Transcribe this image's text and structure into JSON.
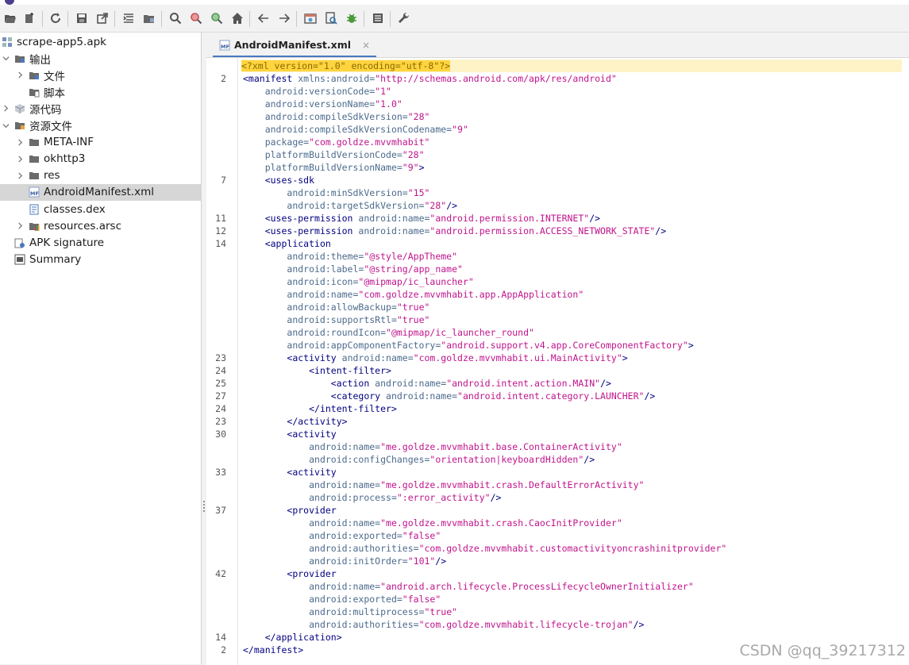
{
  "tree": {
    "items": [
      {
        "label": "scrape-app5.apk",
        "indent": 0,
        "chev": "none",
        "icon": "apk-icon"
      },
      {
        "label": "输出",
        "indent": 1,
        "chev": "down",
        "icon": "folder-output-icon"
      },
      {
        "label": "文件",
        "indent": 2,
        "chev": "right",
        "icon": "folder-output-icon"
      },
      {
        "label": "脚本",
        "indent": 2,
        "chev": "blank",
        "icon": "script-folder-icon"
      },
      {
        "label": "源代码",
        "indent": 1,
        "chev": "right",
        "icon": "package-icon"
      },
      {
        "label": "资源文件",
        "indent": 1,
        "chev": "down",
        "icon": "resources-folder-icon"
      },
      {
        "label": "META-INF",
        "indent": 2,
        "chev": "right",
        "icon": "folder-icon"
      },
      {
        "label": "okhttp3",
        "indent": 2,
        "chev": "right",
        "icon": "folder-icon"
      },
      {
        "label": "res",
        "indent": 2,
        "chev": "right",
        "icon": "folder-icon"
      },
      {
        "label": "AndroidManifest.xml",
        "indent": 2,
        "chev": "blank",
        "icon": "manifest-file-icon",
        "selected": true
      },
      {
        "label": "classes.dex",
        "indent": 2,
        "chev": "blank",
        "icon": "dex-file-icon"
      },
      {
        "label": "resources.arsc",
        "indent": 2,
        "chev": "right",
        "icon": "arsc-file-icon"
      },
      {
        "label": "APK signature",
        "indent": 1,
        "chev": "blank",
        "icon": "signature-icon"
      },
      {
        "label": "Summary",
        "indent": 1,
        "chev": "blank",
        "icon": "summary-icon"
      }
    ]
  },
  "editor": {
    "tab_label": "AndroidManifest.xml",
    "tab_close": "×",
    "gutter": [
      "",
      "2",
      "",
      "",
      "",
      "",
      "",
      "",
      "",
      "7",
      "",
      "",
      "11",
      "12",
      "14",
      "",
      "",
      "",
      "",
      "",
      "",
      "",
      "",
      "23",
      "24",
      "25",
      "27",
      "24",
      "23",
      "30",
      "",
      "",
      "33",
      "",
      "",
      "37",
      "",
      "",
      "",
      "",
      "42",
      "",
      "",
      "",
      "",
      "14",
      "2"
    ],
    "lines": [
      [
        [
          "decl",
          "<?xml version=\"1.0\" encoding=\"utf-8\"?>"
        ]
      ],
      [
        [
          "t",
          "<manifest "
        ],
        [
          "a",
          "xmlns:android="
        ],
        [
          "v",
          "\"http://schemas.android.com/apk/res/android\""
        ]
      ],
      [
        [
          "",
          "    "
        ],
        [
          "a",
          "android:versionCode="
        ],
        [
          "v",
          "\"1\""
        ]
      ],
      [
        [
          "",
          "    "
        ],
        [
          "a",
          "android:versionName="
        ],
        [
          "v",
          "\"1.0\""
        ]
      ],
      [
        [
          "",
          "    "
        ],
        [
          "a",
          "android:compileSdkVersion="
        ],
        [
          "v",
          "\"28\""
        ]
      ],
      [
        [
          "",
          "    "
        ],
        [
          "a",
          "android:compileSdkVersionCodename="
        ],
        [
          "v",
          "\"9\""
        ]
      ],
      [
        [
          "",
          "    "
        ],
        [
          "a",
          "package="
        ],
        [
          "v",
          "\"com.goldze.mvvmhabit\""
        ]
      ],
      [
        [
          "",
          "    "
        ],
        [
          "a",
          "platformBuildVersionCode="
        ],
        [
          "v",
          "\"28\""
        ]
      ],
      [
        [
          "",
          "    "
        ],
        [
          "a",
          "platformBuildVersionName="
        ],
        [
          "v",
          "\"9\""
        ],
        [
          "t",
          ">"
        ]
      ],
      [
        [
          "",
          "    "
        ],
        [
          "t",
          "<uses-sdk"
        ]
      ],
      [
        [
          "",
          "        "
        ],
        [
          "a",
          "android:minSdkVersion="
        ],
        [
          "v",
          "\"15\""
        ]
      ],
      [
        [
          "",
          "        "
        ],
        [
          "a",
          "android:targetSdkVersion="
        ],
        [
          "v",
          "\"28\""
        ],
        [
          "t",
          "/>"
        ]
      ],
      [
        [
          "",
          "    "
        ],
        [
          "t",
          "<uses-permission "
        ],
        [
          "a",
          "android:name="
        ],
        [
          "v",
          "\"android.permission.INTERNET\""
        ],
        [
          "t",
          "/>"
        ]
      ],
      [
        [
          "",
          "    "
        ],
        [
          "t",
          "<uses-permission "
        ],
        [
          "a",
          "android:name="
        ],
        [
          "v",
          "\"android.permission.ACCESS_NETWORK_STATE\""
        ],
        [
          "t",
          "/>"
        ]
      ],
      [
        [
          "",
          "    "
        ],
        [
          "t",
          "<application"
        ]
      ],
      [
        [
          "",
          "        "
        ],
        [
          "a",
          "android:theme="
        ],
        [
          "v",
          "\"@style/AppTheme\""
        ]
      ],
      [
        [
          "",
          "        "
        ],
        [
          "a",
          "android:label="
        ],
        [
          "v",
          "\"@string/app_name\""
        ]
      ],
      [
        [
          "",
          "        "
        ],
        [
          "a",
          "android:icon="
        ],
        [
          "v",
          "\"@mipmap/ic_launcher\""
        ]
      ],
      [
        [
          "",
          "        "
        ],
        [
          "a",
          "android:name="
        ],
        [
          "v",
          "\"com.goldze.mvvmhabit.app.AppApplication\""
        ]
      ],
      [
        [
          "",
          "        "
        ],
        [
          "a",
          "android:allowBackup="
        ],
        [
          "v",
          "\"true\""
        ]
      ],
      [
        [
          "",
          "        "
        ],
        [
          "a",
          "android:supportsRtl="
        ],
        [
          "v",
          "\"true\""
        ]
      ],
      [
        [
          "",
          "        "
        ],
        [
          "a",
          "android:roundIcon="
        ],
        [
          "v",
          "\"@mipmap/ic_launcher_round\""
        ]
      ],
      [
        [
          "",
          "        "
        ],
        [
          "a",
          "android:appComponentFactory="
        ],
        [
          "v",
          "\"android.support.v4.app.CoreComponentFactory\""
        ],
        [
          "t",
          ">"
        ]
      ],
      [
        [
          "",
          "        "
        ],
        [
          "t",
          "<activity "
        ],
        [
          "a",
          "android:name="
        ],
        [
          "v",
          "\"com.goldze.mvvmhabit.ui.MainActivity\""
        ],
        [
          "t",
          ">"
        ]
      ],
      [
        [
          "",
          "            "
        ],
        [
          "t",
          "<intent-filter>"
        ]
      ],
      [
        [
          "",
          "                "
        ],
        [
          "t",
          "<action "
        ],
        [
          "a",
          "android:name="
        ],
        [
          "v",
          "\"android.intent.action.MAIN\""
        ],
        [
          "t",
          "/>"
        ]
      ],
      [
        [
          "",
          "                "
        ],
        [
          "t",
          "<category "
        ],
        [
          "a",
          "android:name="
        ],
        [
          "v",
          "\"android.intent.category.LAUNCHER\""
        ],
        [
          "t",
          "/>"
        ]
      ],
      [
        [
          "",
          "            "
        ],
        [
          "t",
          "</intent-filter>"
        ]
      ],
      [
        [
          "",
          "        "
        ],
        [
          "t",
          "</activity>"
        ]
      ],
      [
        [
          "",
          "        "
        ],
        [
          "t",
          "<activity"
        ]
      ],
      [
        [
          "",
          "            "
        ],
        [
          "a",
          "android:name="
        ],
        [
          "v",
          "\"me.goldze.mvvmhabit.base.ContainerActivity\""
        ]
      ],
      [
        [
          "",
          "            "
        ],
        [
          "a",
          "android:configChanges="
        ],
        [
          "v",
          "\"orientation|keyboardHidden\""
        ],
        [
          "t",
          "/>"
        ]
      ],
      [
        [
          "",
          "        "
        ],
        [
          "t",
          "<activity"
        ]
      ],
      [
        [
          "",
          "            "
        ],
        [
          "a",
          "android:name="
        ],
        [
          "v",
          "\"me.goldze.mvvmhabit.crash.DefaultErrorActivity\""
        ]
      ],
      [
        [
          "",
          "            "
        ],
        [
          "a",
          "android:process="
        ],
        [
          "v",
          "\":error_activity\""
        ],
        [
          "t",
          "/>"
        ]
      ],
      [
        [
          "",
          "        "
        ],
        [
          "t",
          "<provider"
        ]
      ],
      [
        [
          "",
          "            "
        ],
        [
          "a",
          "android:name="
        ],
        [
          "v",
          "\"me.goldze.mvvmhabit.crash.CaocInitProvider\""
        ]
      ],
      [
        [
          "",
          "            "
        ],
        [
          "a",
          "android:exported="
        ],
        [
          "v",
          "\"false\""
        ]
      ],
      [
        [
          "",
          "            "
        ],
        [
          "a",
          "android:authorities="
        ],
        [
          "v",
          "\"com.goldze.mvvmhabit.customactivityoncrashinitprovider\""
        ]
      ],
      [
        [
          "",
          "            "
        ],
        [
          "a",
          "android:initOrder="
        ],
        [
          "v",
          "\"101\""
        ],
        [
          "t",
          "/>"
        ]
      ],
      [
        [
          "",
          "        "
        ],
        [
          "t",
          "<provider"
        ]
      ],
      [
        [
          "",
          "            "
        ],
        [
          "a",
          "android:name="
        ],
        [
          "v",
          "\"android.arch.lifecycle.ProcessLifecycleOwnerInitializer\""
        ]
      ],
      [
        [
          "",
          "            "
        ],
        [
          "a",
          "android:exported="
        ],
        [
          "v",
          "\"false\""
        ]
      ],
      [
        [
          "",
          "            "
        ],
        [
          "a",
          "android:multiprocess="
        ],
        [
          "v",
          "\"true\""
        ]
      ],
      [
        [
          "",
          "            "
        ],
        [
          "a",
          "android:authorities="
        ],
        [
          "v",
          "\"com.goldze.mvvmhabit.lifecycle-trojan\""
        ],
        [
          "t",
          "/>"
        ]
      ],
      [
        [
          "",
          "    "
        ],
        [
          "t",
          "</application>"
        ]
      ],
      [
        [
          "t",
          "</manifest>"
        ]
      ]
    ]
  },
  "watermark": "CSDN @qq_39217312",
  "colors": {
    "accent": "#4a78c2",
    "tag": "#000080",
    "attr": "#4c6a8c",
    "value": "#c0148c",
    "decl_bg": "#ffd43e",
    "line_highlight": "#fdf3c6"
  }
}
